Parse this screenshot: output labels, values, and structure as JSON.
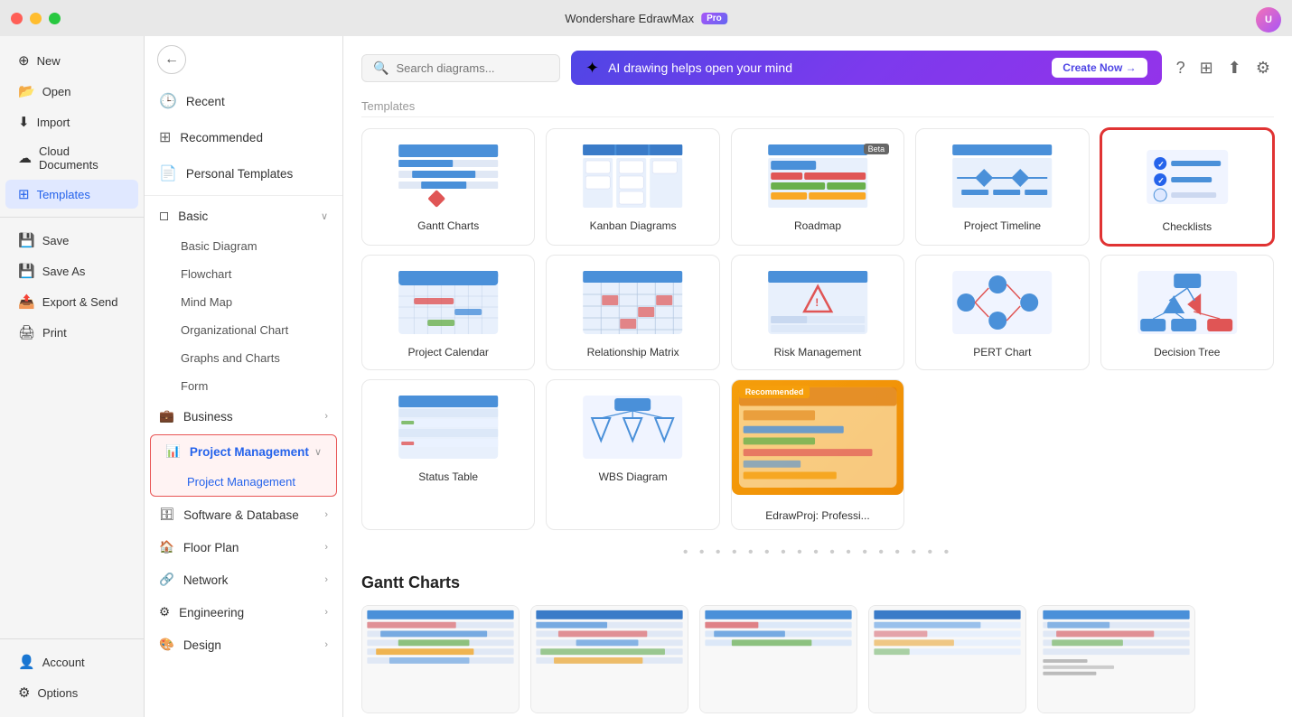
{
  "titleBar": {
    "appName": "Wondershare EdrawMax",
    "proBadge": "Pro"
  },
  "sidebar": {
    "items": [
      {
        "id": "new",
        "label": "New",
        "icon": "+"
      },
      {
        "id": "open",
        "label": "Open",
        "icon": "📁"
      },
      {
        "id": "import",
        "label": "Import",
        "icon": "📥"
      },
      {
        "id": "cloud",
        "label": "Cloud Documents",
        "icon": "☁️"
      },
      {
        "id": "templates",
        "label": "Templates",
        "icon": "🗂",
        "active": true
      },
      {
        "id": "save",
        "label": "Save",
        "icon": "💾"
      },
      {
        "id": "saveas",
        "label": "Save As",
        "icon": "💾"
      },
      {
        "id": "export",
        "label": "Export & Send",
        "icon": "📤"
      },
      {
        "id": "print",
        "label": "Print",
        "icon": "🖨"
      }
    ],
    "bottomItems": [
      {
        "id": "account",
        "label": "Account",
        "icon": "👤"
      },
      {
        "id": "options",
        "label": "Options",
        "icon": "⚙️"
      }
    ]
  },
  "leftPanel": {
    "topItems": [
      {
        "id": "recent",
        "label": "Recent",
        "icon": "🕒"
      },
      {
        "id": "recommended",
        "label": "Recommended",
        "icon": "⭐"
      },
      {
        "id": "personal",
        "label": "Personal Templates",
        "icon": "📄"
      }
    ],
    "sections": [
      {
        "id": "basic",
        "label": "Basic",
        "expanded": true,
        "icon": "◻",
        "children": [
          "Basic Diagram",
          "Flowchart",
          "Mind Map",
          "Organizational Chart",
          "Graphs and Charts",
          "Form"
        ]
      },
      {
        "id": "business",
        "label": "Business",
        "expanded": false,
        "icon": "💼",
        "children": []
      },
      {
        "id": "project",
        "label": "Project Management",
        "expanded": true,
        "icon": "📊",
        "children": [
          "Project Management"
        ],
        "active": true,
        "activeChild": "Project Management"
      },
      {
        "id": "software",
        "label": "Software & Database",
        "expanded": false,
        "icon": "🗄",
        "children": []
      },
      {
        "id": "floorplan",
        "label": "Floor Plan",
        "expanded": false,
        "icon": "🏠",
        "children": []
      },
      {
        "id": "network",
        "label": "Network",
        "expanded": false,
        "icon": "🔗",
        "children": []
      },
      {
        "id": "engineering",
        "label": "Engineering",
        "expanded": false,
        "icon": "⚙",
        "children": []
      },
      {
        "id": "design",
        "label": "Design",
        "expanded": false,
        "icon": "🎨",
        "children": []
      }
    ]
  },
  "topBar": {
    "searchPlaceholder": "Search diagrams...",
    "aiBannerText": "AI drawing helps open your mind",
    "createNowLabel": "Create Now →"
  },
  "sectionLabel": "Templates",
  "templateCards": [
    {
      "id": "gantt",
      "title": "Gantt Charts",
      "type": "gantt"
    },
    {
      "id": "kanban",
      "title": "Kanban Diagrams",
      "type": "kanban",
      "badge": ""
    },
    {
      "id": "roadmap",
      "title": "Roadmap",
      "type": "roadmap",
      "badge": "Beta"
    },
    {
      "id": "timeline",
      "title": "Project Timeline",
      "type": "timeline"
    },
    {
      "id": "checklists",
      "title": "Checklists",
      "type": "checklists",
      "selected": true
    }
  ],
  "templateCards2": [
    {
      "id": "calendar",
      "title": "Project Calendar",
      "type": "calendar"
    },
    {
      "id": "matrix",
      "title": "Relationship Matrix",
      "type": "matrix"
    },
    {
      "id": "risk",
      "title": "Risk Management",
      "type": "risk"
    },
    {
      "id": "pert",
      "title": "PERT Chart",
      "type": "pert"
    },
    {
      "id": "decision",
      "title": "Decision Tree",
      "type": "decision"
    }
  ],
  "templateCards3": [
    {
      "id": "status",
      "title": "Status Table",
      "type": "status"
    },
    {
      "id": "wbs",
      "title": "WBS Diagram",
      "type": "wbs"
    },
    {
      "id": "edrawproj",
      "title": "EdrawProj: Professi...",
      "type": "edrawproj",
      "badge": "Recommended"
    }
  ],
  "bottomSection": {
    "title": "Gantt Charts",
    "thumbs": [
      1,
      2,
      3,
      4,
      5
    ]
  }
}
